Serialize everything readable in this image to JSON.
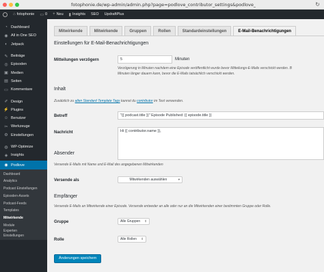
{
  "browser": {
    "url": "fotophonie.de/wp-admin/admin.php?page=podlove_contributor_settings&podlove_tab",
    "lights": [
      "#fc605c",
      "#fdbc40",
      "#34c84a"
    ]
  },
  "adminbar": {
    "site": "fotophonie",
    "comments": "0",
    "new": "Neu",
    "insights": "Insights",
    "seo": "SEO",
    "updraft": "UpdraftPlus"
  },
  "sidebar": {
    "items": [
      {
        "label": "Dashboard",
        "icon": "dashboard-icon",
        "glyph": "◔"
      },
      {
        "label": "All in One SEO",
        "icon": "seo-icon",
        "glyph": "◉"
      },
      {
        "label": "Jetpack",
        "icon": "jetpack-icon",
        "glyph": "◐"
      },
      {
        "label": "Beiträge",
        "icon": "pin-icon",
        "glyph": "✎"
      },
      {
        "label": "Episoden",
        "icon": "podcast-icon",
        "glyph": "◎"
      },
      {
        "label": "Medien",
        "icon": "media-icon",
        "glyph": "▣"
      },
      {
        "label": "Seiten",
        "icon": "pages-icon",
        "glyph": "▤"
      },
      {
        "label": "Kommentare",
        "icon": "comments-icon",
        "glyph": "▭"
      },
      {
        "label": "Design",
        "icon": "brush-icon",
        "glyph": "✐"
      },
      {
        "label": "Plugins",
        "icon": "plugin-icon",
        "glyph": "⚡"
      },
      {
        "label": "Benutzer",
        "icon": "users-icon",
        "glyph": "☺"
      },
      {
        "label": "Werkzeuge",
        "icon": "tools-icon",
        "glyph": "✂"
      },
      {
        "label": "Einstellungen",
        "icon": "settings-icon",
        "glyph": "⚙"
      },
      {
        "label": "WP-Optimize",
        "icon": "optimize-icon",
        "glyph": "◍"
      },
      {
        "label": "Insights",
        "icon": "insights-icon",
        "glyph": "◈"
      }
    ],
    "current": {
      "label": "Podlove",
      "icon": "podlove-icon",
      "glyph": "◉"
    },
    "submenu": [
      "Dashboard",
      "Analytics",
      "Podcast Einstellungen",
      "Episoden-Assets",
      "Podcast-Feeds",
      "Templates",
      "Mitwirkende",
      "Module",
      "Experten Einstellungen"
    ]
  },
  "tabs": [
    "Mitwirkende",
    "Mitwirkende",
    "Gruppen",
    "Rollen",
    "Standardeinstellungen",
    "E-Mail-Benachrichtigungen"
  ],
  "section1": {
    "title": "Einstellungen für E-Mail-Benachrichtigungen",
    "delay_label": "Mitteilungen verzögern",
    "delay_value": "5",
    "delay_unit": "Minuten",
    "delay_desc1": "Verzögerung in Minuten nachdem eine Episode veröffentlicht wurde bevor Mitteilungs-E-Mails verschickt werden. B",
    "delay_desc2": "Minuten länger dauern kann, bevor die E-Mails tatsächlich verschickt werden."
  },
  "section2": {
    "title": "Inhalt",
    "intro_pre": "Zusätzlich zu ",
    "intro_link1": "allen Standard Template Tags",
    "intro_mid": " kannst du ",
    "intro_link2": "contributor",
    "intro_post": " im Text verwenden.",
    "subject_label": "Betreff",
    "subject_value": "\"{{ podcast.title }}\" Episode Published: {{ episode.title }}",
    "message_label": "Nachricht",
    "message_value": "Hi {{ contributor.name }},"
  },
  "section3": {
    "title": "Absender",
    "desc": "Versende E-Mails mit Name und E-Mail des angegebenen Mitwirkenden",
    "sender_label": "Versende als",
    "sender_value": "Mitwirkenden auswählen"
  },
  "section4": {
    "title": "Empfänger",
    "desc": "Versende E-Mails an Mitwirkende einer Episode. Versende entweder an alle oder nur an die Mitwirkenden einer bestimmten Gruppe oder Rolle.",
    "group_label": "Gruppe",
    "group_value": "Alle Gruppen",
    "role_label": "Rolle",
    "role_value": "Alle Rollen"
  },
  "save_label": "Änderungen speichern"
}
